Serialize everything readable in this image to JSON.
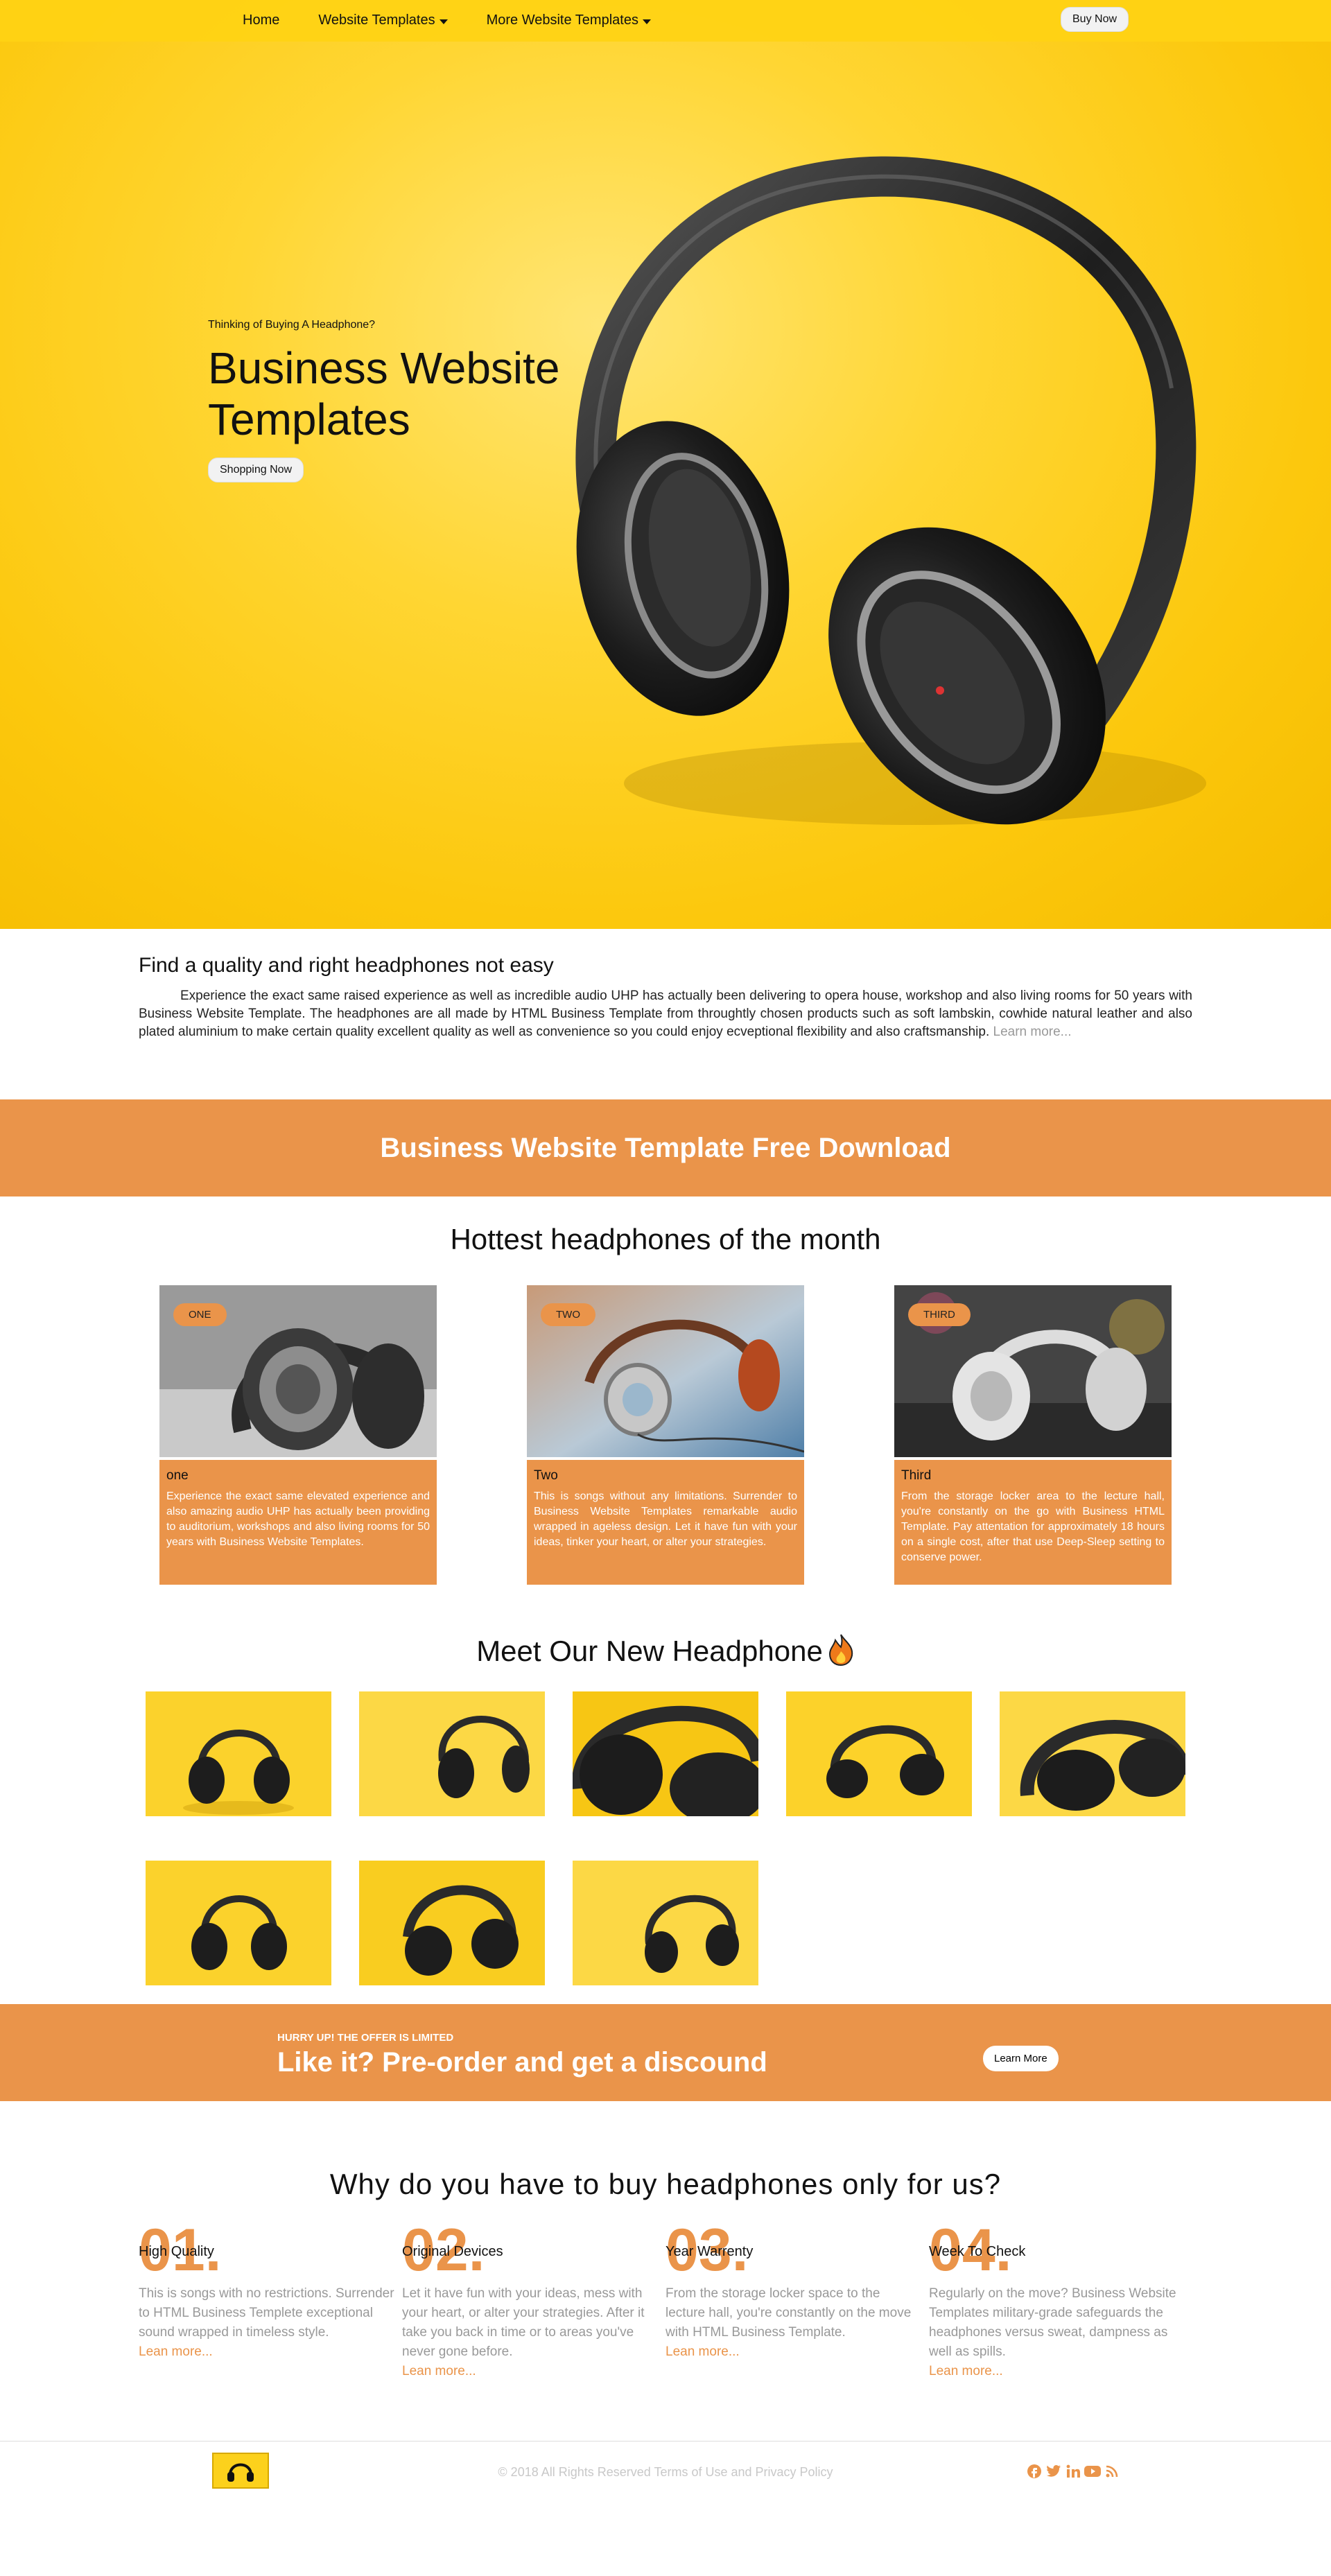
{
  "nav": {
    "home": "Home",
    "website_templates": "Website Templates",
    "more_templates": "More Website Templates",
    "buy_now": "Buy Now"
  },
  "hero": {
    "kicker": "Thinking of Buying A Headphone?",
    "title": "Business Website Templates",
    "cta": "Shopping Now"
  },
  "intro": {
    "heading": "Find a quality and right headphones not easy",
    "body": "Experience the exact same raised experience as well as incredible audio UHP has actually been delivering to opera house, workshop and also living rooms for 50 years with Business Website Template. The headphones are all made by HTML Business Template from throughtly chosen products such as soft lambskin, cowhide natural leather and also plated aluminium to make certain quality excellent quality as well as convenience so you could enjoy ecveptional flexibility and also craftsmanship.",
    "more": "Learn more..."
  },
  "banner": {
    "text": "Business Website Template Free Download"
  },
  "hottest": {
    "title": "Hottest headphones of the month",
    "cards": [
      {
        "badge": "ONE",
        "title": "one",
        "text": "Experience the exact same elevated experience and also amazing audio UHP has actually been providing to auditorium, workshops and also living rooms for 50 years with Business Website Templates."
      },
      {
        "badge": "TWO",
        "title": "Two",
        "text": "This is songs without any limitations. Surrender to Business Website Templates remarkable audio wrapped in ageless design. Let it have fun with your ideas, tinker your heart, or alter your strategies."
      },
      {
        "badge": "THIRD",
        "title": "Third",
        "text": "From the storage locker area to the lecture hall, you're constantly on the go with Business HTML Template. Pay attentation for approximately 18 hours on a single cost, after that use Deep-Sleep setting to conserve power."
      }
    ]
  },
  "meet": {
    "title": "Meet Our New Headphone",
    "icon": "fire-icon"
  },
  "preorder": {
    "kicker": "HURRY UP! THE OFFER IS LIMITED",
    "title": "Like it? Pre-order and get a discound",
    "button": "Learn More"
  },
  "why": {
    "title": "Why do you have to buy headphones only for us?",
    "features": [
      {
        "num": "01.",
        "title": "High Quality",
        "text": "This is songs with no restrictions. Surrender to HTML Business Templete exceptional sound wrapped in timeless style.",
        "more": "Lean more..."
      },
      {
        "num": "02.",
        "title": "Original Devices",
        "text": "Let it have fun with your ideas, mess with your heart, or alter your strategies. After it take you back in time or to areas you've never gone before.",
        "more": "Lean more..."
      },
      {
        "num": "03.",
        "title": "Year Warrenty",
        "text": "From the storage locker space to the lecture hall, you're constantly on the move with HTML Business Template.",
        "more": "Lean more..."
      },
      {
        "num": "04.",
        "title": "Week To Check",
        "text": "Regularly on the move? Business Website Templates military-grade safeguards the headphones versus sweat, dampness as well as spills.",
        "more": "Lean more..."
      }
    ]
  },
  "footer": {
    "copyright": "© 2018 All Rights Reserved Terms of Use and Privacy Policy",
    "socials": [
      "facebook-icon",
      "twitter-icon",
      "linkedin-icon",
      "youtube-icon",
      "rss-icon"
    ],
    "accent": "#ea944a"
  },
  "colors": {
    "brand_yellow": "#fcc80d",
    "accent_orange": "#ea944a"
  }
}
